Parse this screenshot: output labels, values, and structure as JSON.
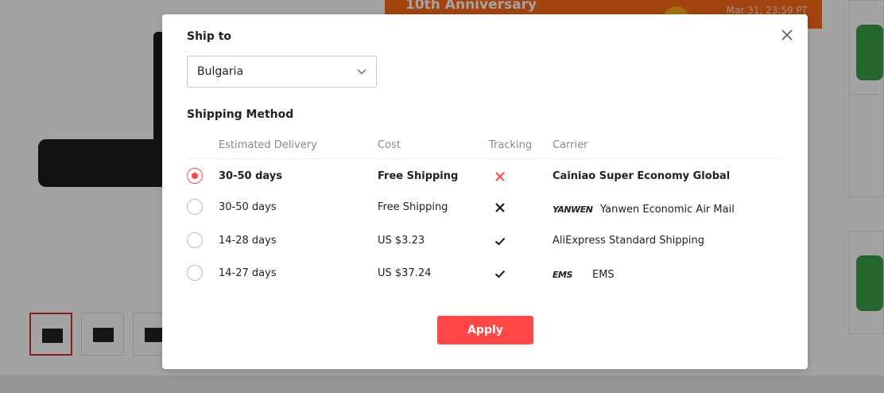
{
  "background": {
    "banner_title": "10th Anniversary",
    "banner_date": "Mar 31, 23:59 PT"
  },
  "modal": {
    "ship_to_title": "Ship to",
    "country": "Bulgaria",
    "method_title": "Shipping Method",
    "headers": {
      "delivery": "Estimated Delivery",
      "cost": "Cost",
      "tracking": "Tracking",
      "carrier": "Carrier"
    },
    "rows": [
      {
        "delivery": "30-50 days",
        "cost": "Free Shipping",
        "tracking": "no",
        "carrier_logo": "",
        "carrier": "Cainiao Super Economy Global",
        "selected": true
      },
      {
        "delivery": "30-50 days",
        "cost": "Free Shipping",
        "tracking": "no",
        "carrier_logo": "YANWEN",
        "carrier": "Yanwen Economic Air Mail",
        "selected": false
      },
      {
        "delivery": "14-28 days",
        "cost": "US $3.23",
        "tracking": "yes",
        "carrier_logo": "",
        "carrier": "AliExpress Standard Shipping",
        "selected": false
      },
      {
        "delivery": "14-27 days",
        "cost": "US $37.24",
        "tracking": "yes",
        "carrier_logo": "EMS",
        "carrier": "EMS",
        "selected": false
      }
    ],
    "apply_label": "Apply"
  },
  "colors": {
    "accent": "#ff4747",
    "banner": "#ff6a1a"
  },
  "icons": {
    "close": "close-icon",
    "chevron": "chevron-down-icon",
    "no_tracking": "cross-icon",
    "tracking": "check-icon"
  }
}
